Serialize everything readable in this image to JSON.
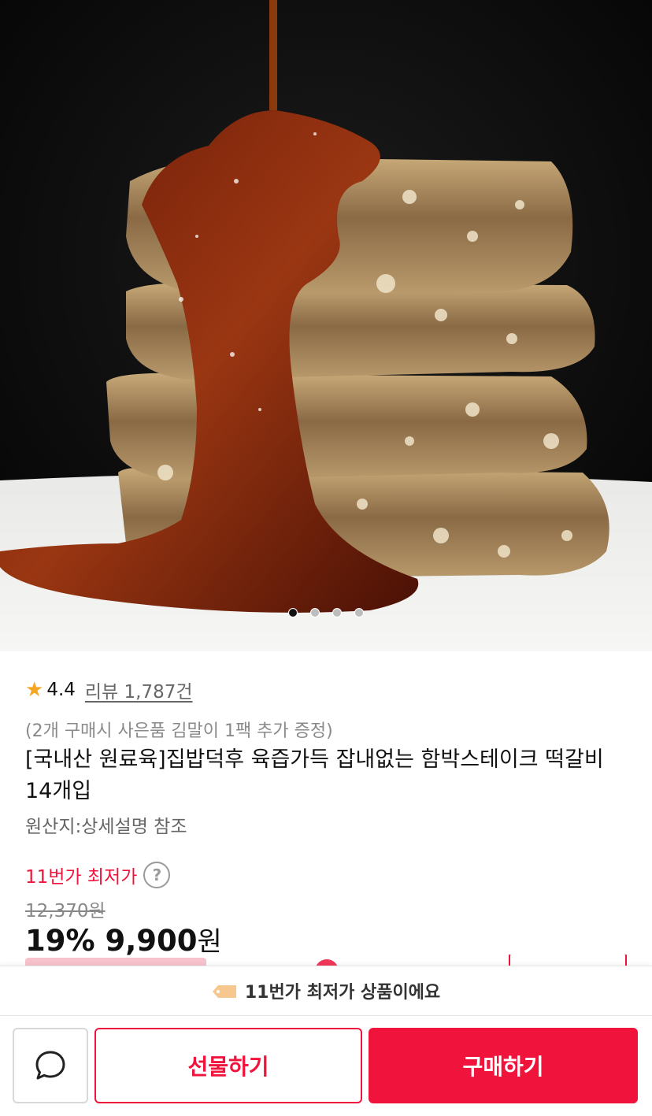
{
  "product": {
    "image_alt": "photo-steak-stack-with-sauce",
    "carousel": {
      "total": 4,
      "active": 1
    },
    "rating": "4.4",
    "review_link": "리뷰 1,787건",
    "promo_note": "(2개 구매시 사은품 김말이 1팩 추가 증정)",
    "title": "[국내산 원료육]집밥덕후 육즙가득 잡내없는 함박스테이크 떡갈비 14개입",
    "origin": "원산지:상세설명 참조"
  },
  "pricing": {
    "lowest_label": "11번가 최저가",
    "help_icon": "?",
    "original_price": "12,370원",
    "discount_rate": "19%",
    "sale_price": "9,900",
    "currency": "원"
  },
  "banner": {
    "icon": "price-tag-icon",
    "text": "11번가 최저가 상품이에요"
  },
  "actions": {
    "chat_icon": "chat-bubble-icon",
    "gift_label": "선물하기",
    "buy_label": "구매하기"
  },
  "colors": {
    "accent": "#f0143c",
    "star": "#f5a623"
  }
}
